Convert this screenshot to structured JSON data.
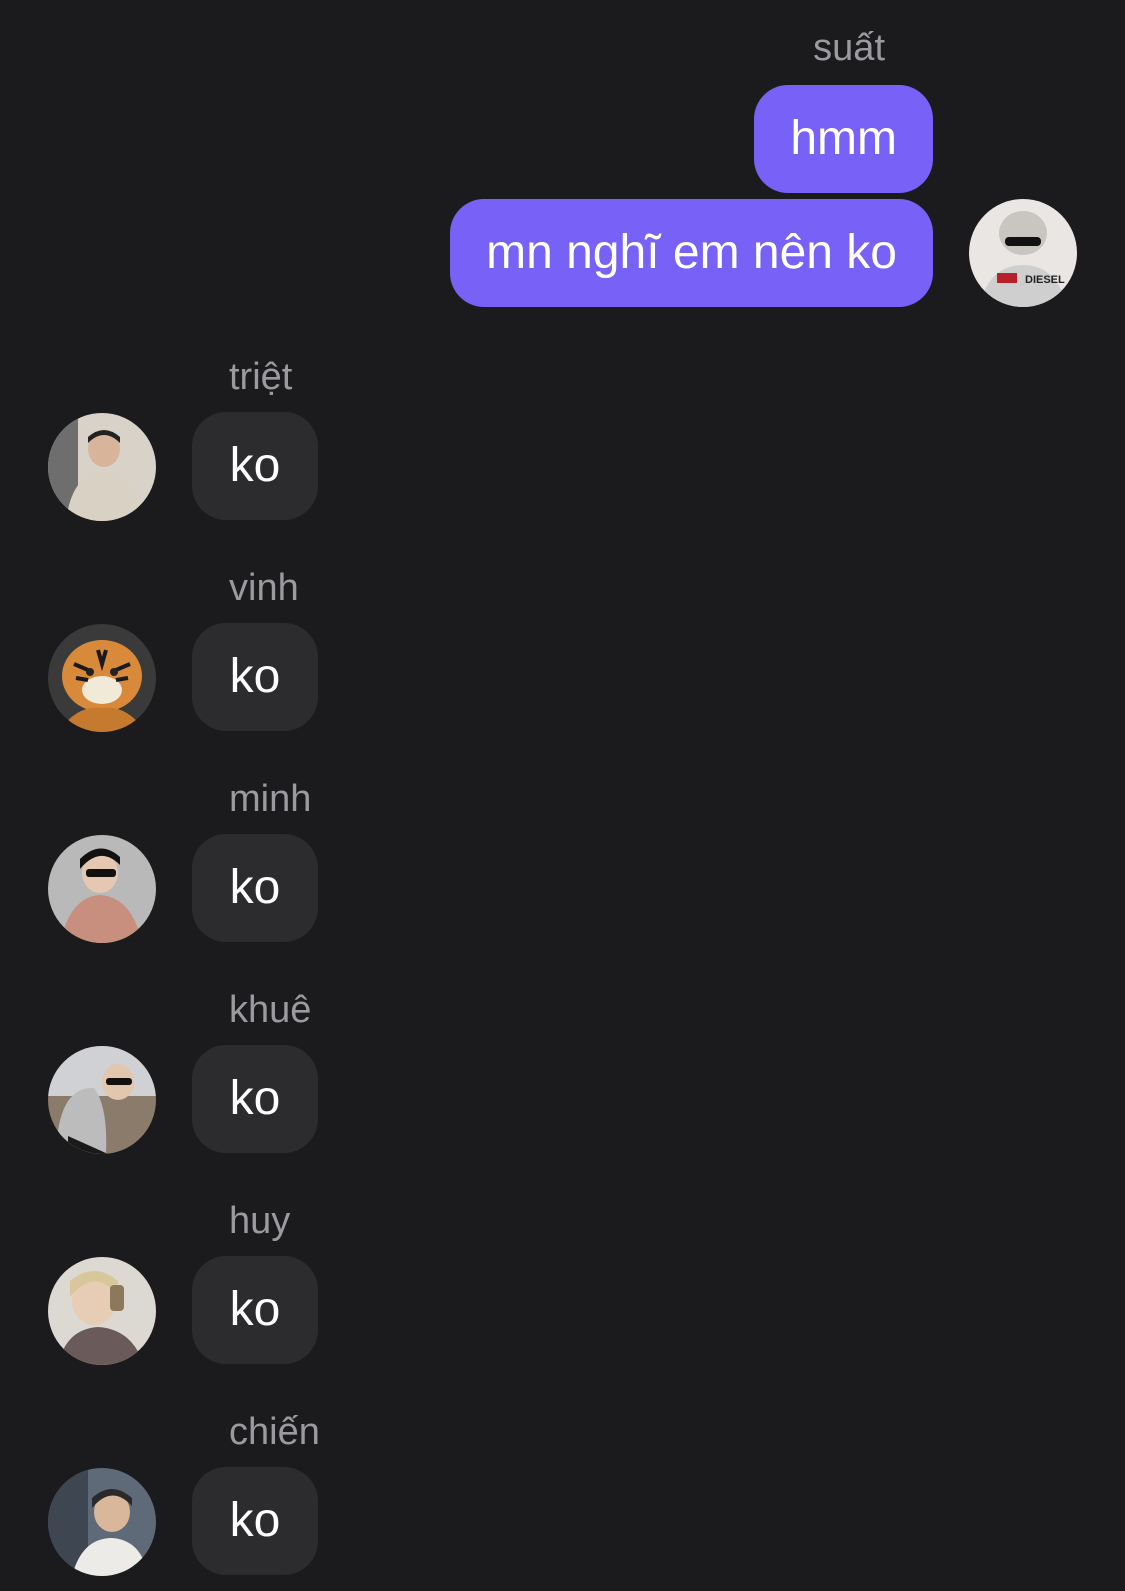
{
  "conversation": {
    "outgoing": {
      "sender": "suất",
      "avatar_icon": "user-avatar-suat-icon",
      "messages": [
        "hmm",
        "mn nghĩ em nên ko"
      ]
    },
    "incoming": [
      {
        "sender": "triệt",
        "text": "ko",
        "avatar_icon": "user-avatar-triet-icon"
      },
      {
        "sender": "vinh",
        "text": "ko",
        "avatar_icon": "user-avatar-vinh-tiger-icon"
      },
      {
        "sender": "minh",
        "text": "ko",
        "avatar_icon": "user-avatar-minh-icon"
      },
      {
        "sender": "khuê",
        "text": "ko",
        "avatar_icon": "user-avatar-khue-icon"
      },
      {
        "sender": "huy",
        "text": "ko",
        "avatar_icon": "user-avatar-huy-icon"
      },
      {
        "sender": "chiến",
        "text": "ko",
        "avatar_icon": "user-avatar-chien-icon"
      }
    ]
  },
  "colors": {
    "background": "#1b1b1d",
    "outgoing_bubble": "#7761f6",
    "incoming_bubble": "#2c2c2e",
    "sender_name": "#9a9a9f",
    "message_text": "#ffffff"
  }
}
